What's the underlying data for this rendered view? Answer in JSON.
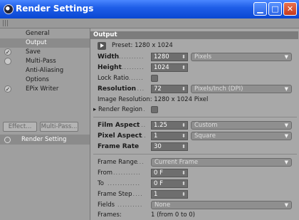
{
  "window": {
    "title": "Render Settings"
  },
  "sidebar": {
    "items": [
      {
        "label": "General",
        "checked": null
      },
      {
        "label": "Output",
        "checked": null,
        "selected": true
      },
      {
        "label": "Save",
        "checked": true
      },
      {
        "label": "Multi-Pass",
        "checked": false
      },
      {
        "label": "Anti-Aliasing",
        "checked": null
      },
      {
        "label": "Options",
        "checked": null
      },
      {
        "label": "EPix Writer",
        "checked": true
      }
    ],
    "effect_button": "Effect...",
    "multipass_button": "Multi-Pass...",
    "render_setting": "Render Setting"
  },
  "output": {
    "section": "Output",
    "preset": "Preset: 1280 x 1024",
    "width_label": "Width",
    "width_value": "1280",
    "width_unit": "Pixels",
    "height_label": "Height",
    "height_value": "1024",
    "lock_ratio_label": "Lock Ratio",
    "resolution_label": "Resolution",
    "resolution_value": "72",
    "resolution_unit": "Pixels/Inch (DPI)",
    "image_resolution": "Image Resolution: 1280 x 1024 Pixel",
    "render_region_label": "Render Region",
    "film_aspect_label": "Film Aspect",
    "film_aspect_value": "1.25",
    "film_aspect_preset": "Custom",
    "pixel_aspect_label": "Pixel Aspect",
    "pixel_aspect_value": "1",
    "pixel_aspect_preset": "Square",
    "frame_rate_label": "Frame Rate",
    "frame_rate_value": "30",
    "frame_range_label": "Frame Range",
    "frame_range_value": "Current Frame",
    "from_label": "From",
    "from_value": "0 F",
    "to_label": "To",
    "to_value": "0 F",
    "frame_step_label": "Frame Step",
    "frame_step_value": "1",
    "fields_label": "Fields",
    "fields_value": "None",
    "frames_label": "Frames:",
    "frames_value": "1 (from 0 to 0)"
  }
}
